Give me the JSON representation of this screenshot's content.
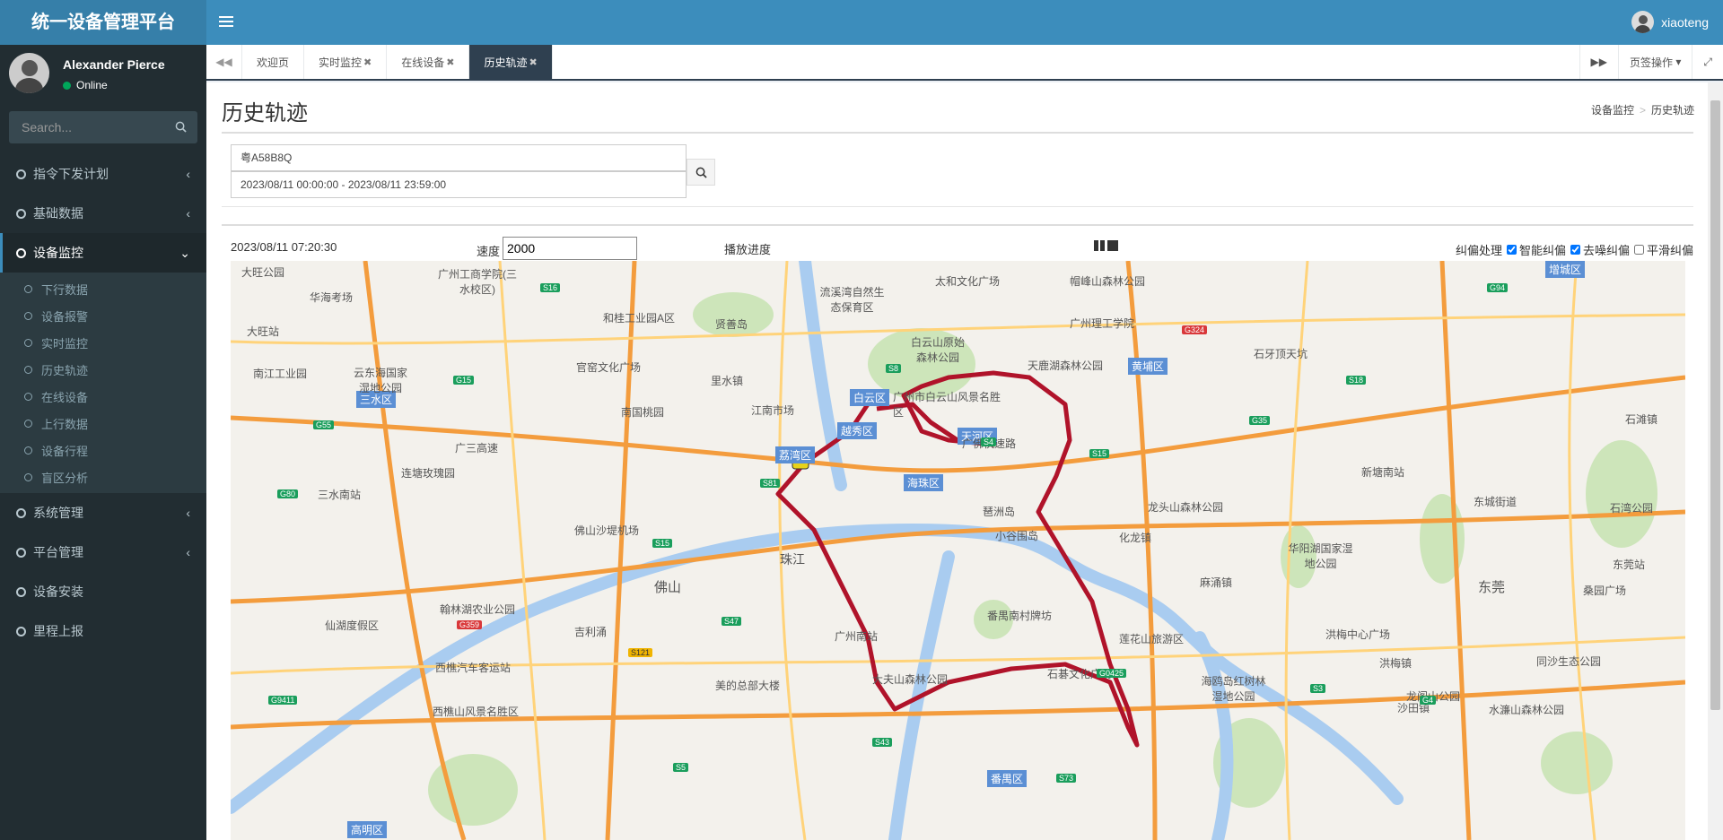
{
  "app": {
    "title": "统一设备管理平台",
    "username": "xiaoteng"
  },
  "user_panel": {
    "name": "Alexander Pierce",
    "status": "Online"
  },
  "search": {
    "placeholder": "Search..."
  },
  "sidebar": {
    "items": [
      {
        "label": "指令下发计划",
        "has_children": true
      },
      {
        "label": "基础数据",
        "has_children": true
      },
      {
        "label": "设备监控",
        "active": true,
        "expanded": true,
        "children": [
          "下行数据",
          "设备报警",
          "实时监控",
          "历史轨迹",
          "在线设备",
          "上行数据",
          "设备行程",
          "盲区分析"
        ]
      },
      {
        "label": "系统管理",
        "has_children": true
      },
      {
        "label": "平台管理",
        "has_children": true
      },
      {
        "label": "设备安装"
      },
      {
        "label": "里程上报"
      }
    ]
  },
  "tabs": [
    {
      "label": "欢迎页",
      "closable": false
    },
    {
      "label": "实时监控",
      "closable": true
    },
    {
      "label": "在线设备",
      "closable": true
    },
    {
      "label": "历史轨迹",
      "closable": true,
      "active": true
    }
  ],
  "tab_ops_label": "页签操作",
  "page": {
    "title": "历史轨迹",
    "breadcrumb": [
      "设备监控",
      "历史轨迹"
    ]
  },
  "query": {
    "plate": "粤A58B8Q",
    "date_range": "2023/08/11 00:00:00 - 2023/08/11 23:59:00"
  },
  "player": {
    "timestamp": "2023/08/11 07:20:30",
    "speed_label": "速度",
    "speed_value": "2000",
    "progress_label": "播放进度",
    "correction_label": "纠偏处理",
    "options": [
      {
        "label": "智能纠偏",
        "checked": true
      },
      {
        "label": "去噪纠偏",
        "checked": true
      },
      {
        "label": "平滑纠偏",
        "checked": false
      }
    ]
  },
  "map": {
    "districts": [
      "白云区",
      "越秀区",
      "天河区",
      "荔湾区",
      "海珠区",
      "黄埔区",
      "番禺区",
      "三水区",
      "增城区",
      "高明区"
    ],
    "places": [
      "大旺公园",
      "广州工商学院(三水校区)",
      "华海考场",
      "和桂工业园A区",
      "贤善岛",
      "流溪湾自然生态保育区",
      "太和文化广场",
      "帽峰山森林公园",
      "广州理工学院",
      "白云山原始森林公园",
      "广州市白云山风景名胜区",
      "天鹿湖森林公园",
      "石牙顶天坑",
      "大旺站",
      "南江工业园",
      "云东海国家湿地公园",
      "官窑文化广场",
      "南国桃园",
      "江南市场",
      "里水镇",
      "广佛快速路",
      "广三高速",
      "连塘玫瑰园",
      "三水南站",
      "佛山沙堤机场",
      "新塘南站",
      "龙头山森林公园",
      "琶洲岛",
      "华阳湖国家湿地公园",
      "东莞",
      "佛山",
      "珠江",
      "吉利涌",
      "广州南站",
      "番禺南村牌坊",
      "莲花山旅游区",
      "海鸥岛红树林湿地公园",
      "洪梅中心广场",
      "同沙生态公园",
      "西樵汽车客运站",
      "西樵山风景名胜区",
      "美的总部大楼",
      "大夫山森林公园",
      "石碁文化广场",
      "龙阁山公园",
      "水濂山森林公园",
      "东莞站",
      "桑园广场",
      "石湾公园",
      "仙湖度假区",
      "翰林湖农业公园",
      "小谷围岛",
      "化龙镇",
      "石滩镇",
      "东城街道",
      "麻涌镇",
      "洪梅镇",
      "沙田镇"
    ],
    "highways": [
      "S16",
      "G15",
      "G55",
      "S8",
      "S4",
      "S15",
      "G35",
      "S18",
      "G324",
      "G94",
      "S81",
      "G80",
      "S43",
      "S47",
      "G359",
      "S121",
      "G9411",
      "S5",
      "S15",
      "G0425",
      "S3",
      "S73",
      "G4"
    ]
  }
}
